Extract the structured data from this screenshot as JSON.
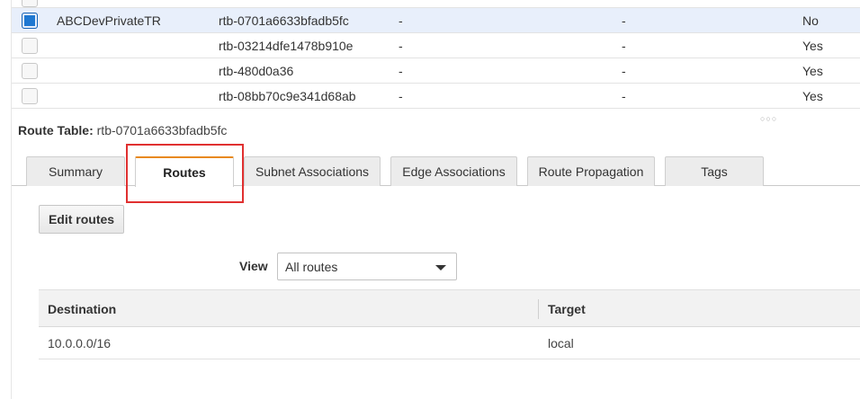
{
  "route_tables": {
    "rows": [
      {
        "name": "",
        "id": "",
        "col_a": "",
        "col_b": "",
        "main": "",
        "checked": false,
        "partial": true
      },
      {
        "name": "ABCDevPrivateTR",
        "id": "rtb-0701a6633bfadb5fc",
        "col_a": "-",
        "col_b": "-",
        "main": "No",
        "checked": true
      },
      {
        "name": "",
        "id": "rtb-03214dfe1478b910e",
        "col_a": "-",
        "col_b": "-",
        "main": "Yes",
        "checked": false
      },
      {
        "name": "",
        "id": "rtb-480d0a36",
        "col_a": "-",
        "col_b": "-",
        "main": "Yes",
        "checked": false
      },
      {
        "name": "",
        "id": "rtb-08bb70c9e341d68ab",
        "col_a": "-",
        "col_b": "-",
        "main": "Yes",
        "checked": false
      }
    ]
  },
  "detail": {
    "label": "Route Table:",
    "value": "rtb-0701a6633bfadb5fc"
  },
  "tabs": [
    {
      "label": "Summary",
      "active": false
    },
    {
      "label": "Routes",
      "active": true
    },
    {
      "label": "Subnet Associations",
      "active": false
    },
    {
      "label": "Edge Associations",
      "active": false
    },
    {
      "label": "Route Propagation",
      "active": false
    },
    {
      "label": "Tags",
      "active": false
    }
  ],
  "routes": {
    "edit_button": "Edit routes",
    "view_label": "View",
    "view_value": "All routes",
    "columns": [
      "Destination",
      "Target"
    ],
    "rows": [
      {
        "destination": "10.0.0.0/16",
        "target": "local"
      }
    ]
  },
  "colors": {
    "tab_active_accent": "#e8891c",
    "highlight": "#e03030",
    "checkbox_checked": "#1f78d1",
    "selected_row": "#e8effb"
  }
}
